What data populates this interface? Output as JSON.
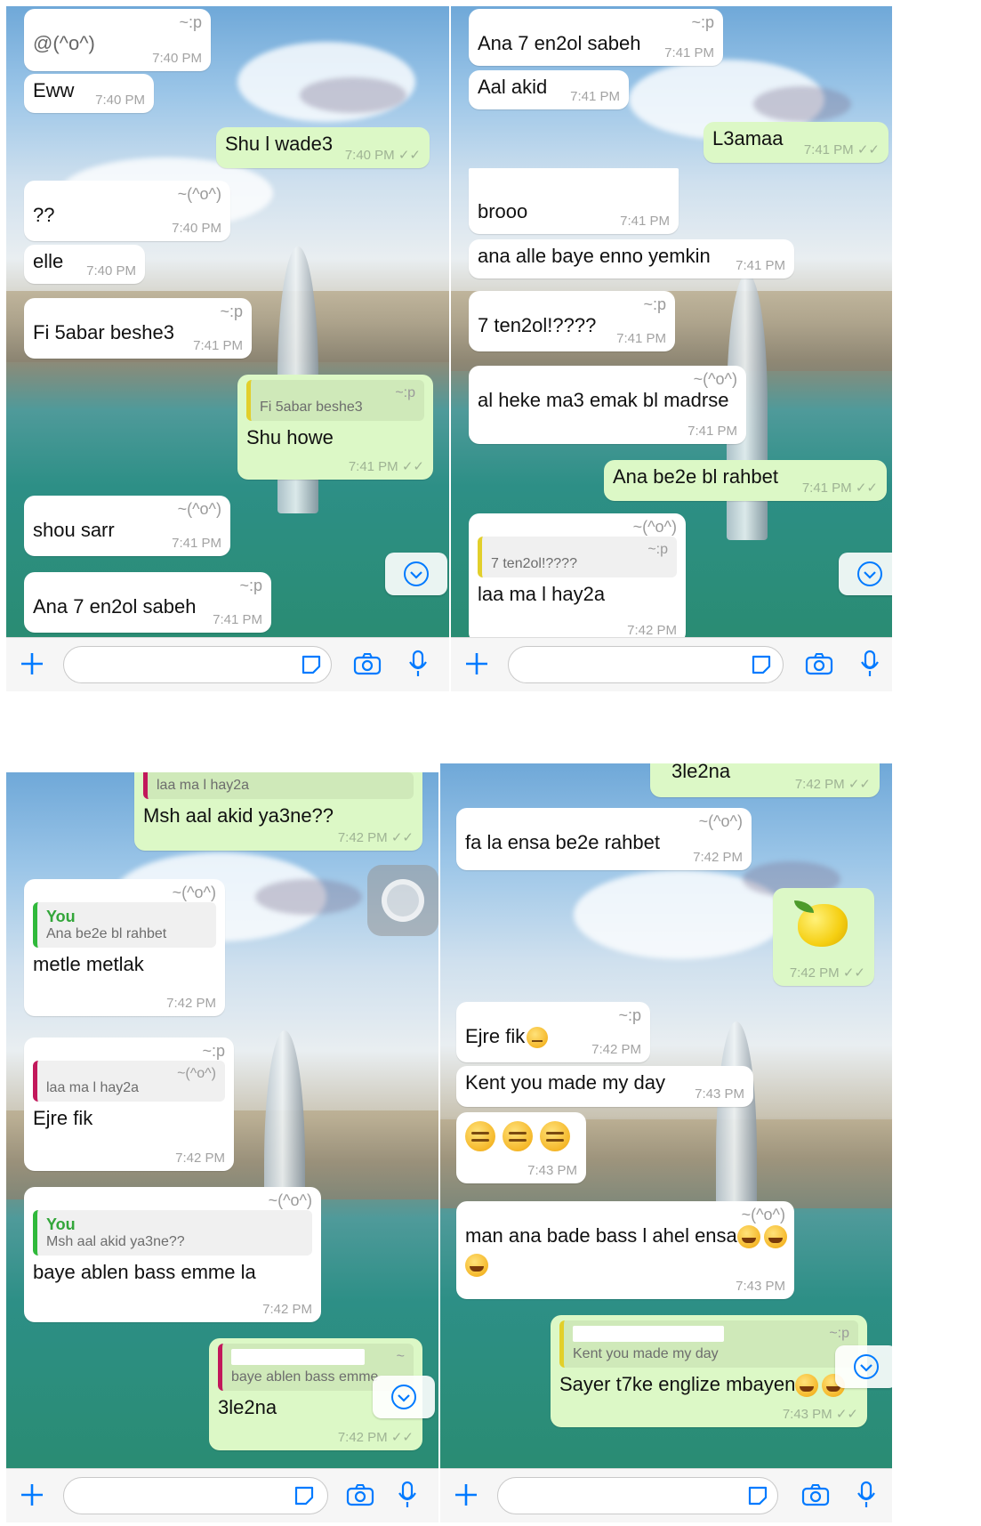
{
  "panels": [
    {
      "messages": [
        {
          "dir": "in",
          "sender": "~:p",
          "text": "@(^o^)",
          "time": "7:40 PM"
        },
        {
          "dir": "in",
          "text": "Eww",
          "time": "7:40 PM"
        },
        {
          "dir": "out",
          "text": "Shu l wade3",
          "time": "7:40 PM"
        },
        {
          "dir": "in",
          "sender": "~(^o^)",
          "text": "??",
          "time": "7:40 PM"
        },
        {
          "dir": "in",
          "text": "elle",
          "time": "7:40 PM"
        },
        {
          "dir": "in",
          "sender": "~:p",
          "text": "Fi 5abar beshe3",
          "time": "7:41 PM"
        },
        {
          "dir": "out",
          "quote_tag": "~:p",
          "quote_text": "Fi 5abar beshe3",
          "text": "Shu howe",
          "time": "7:41 PM"
        },
        {
          "dir": "in",
          "sender": "~(^o^)",
          "text": "shou sarr",
          "time": "7:41 PM"
        },
        {
          "dir": "in",
          "sender": "~:p",
          "text": "Ana 7 en2ol sabeh",
          "time": "7:41 PM"
        }
      ]
    },
    {
      "messages": [
        {
          "dir": "in",
          "sender": "~:p",
          "text": "Ana 7 en2ol sabeh",
          "time": "7:41 PM"
        },
        {
          "dir": "in",
          "text": "Aal akid",
          "time": "7:41 PM"
        },
        {
          "dir": "out",
          "text": "L3amaa",
          "time": "7:41 PM"
        },
        {
          "dir": "in",
          "text": "brooo",
          "time": "7:41 PM"
        },
        {
          "dir": "in",
          "text": "ana alle baye enno yemkin",
          "time": "7:41 PM"
        },
        {
          "dir": "in",
          "sender": "~:p",
          "text": "7 ten2ol!????",
          "time": "7:41 PM"
        },
        {
          "dir": "in",
          "sender": "~(^o^)",
          "text": "al heke ma3 emak bl madrse",
          "time": "7:41 PM"
        },
        {
          "dir": "out",
          "text": "Ana be2e bl rahbet",
          "time": "7:41 PM"
        },
        {
          "dir": "in",
          "sender": "~(^o^)",
          "quote_tag": "~:p",
          "quote_text": "7 ten2ol!????",
          "text": "laa ma l hay2a",
          "time": "7:42 PM"
        }
      ]
    },
    {
      "messages": [
        {
          "dir": "out",
          "quote_text": "laa ma l hay2a",
          "text": "Msh aal akid ya3ne??",
          "time": "7:42 PM"
        },
        {
          "dir": "in",
          "sender": "~(^o^)",
          "quote_author": "You",
          "quote_text": "Ana be2e bl rahbet",
          "text": "metle metlak",
          "time": "7:42 PM"
        },
        {
          "dir": "in",
          "sender": "~:p",
          "quote_tag": "~(^o^)",
          "quote_text": "laa ma l hay2a",
          "text": "Ejre fik",
          "time": "7:42 PM"
        },
        {
          "dir": "in",
          "sender": "~(^o^)",
          "quote_author": "You",
          "quote_text": "Msh aal akid ya3ne??",
          "text": "baye ablen bass emme la",
          "time": "7:42 PM"
        },
        {
          "dir": "out",
          "quote_tag": "~",
          "quote_text": "baye ablen bass emme",
          "text": "3le2na",
          "time": "7:42 PM"
        }
      ]
    },
    {
      "messages": [
        {
          "dir": "out",
          "text": "3le2na",
          "time": "7:42 PM"
        },
        {
          "dir": "in",
          "sender": "~(^o^)",
          "text": "fa la ensa be2e rahbet",
          "time": "7:42 PM"
        },
        {
          "dir": "out",
          "emoji": "lemon",
          "time": "7:42 PM"
        },
        {
          "dir": "in",
          "sender": "~:p",
          "text": "Ejre fik",
          "emoji_inline": "neutral-face",
          "time": "7:42 PM"
        },
        {
          "dir": "in",
          "text": "Kent you made my day",
          "time": "7:43 PM"
        },
        {
          "dir": "in",
          "emoji": "three-expressionless-faces",
          "time": "7:43 PM"
        },
        {
          "dir": "in",
          "sender": "~(^o^)",
          "text": "man ana bade bass l ahel ensa",
          "emoji_inline": "laughing-faces",
          "time": "7:43 PM"
        },
        {
          "dir": "out",
          "quote_tag": "~:p",
          "quote_text": "Kent you made my day",
          "text": "Sayer t7ke englize mbayen",
          "emoji_inline": "laughing-faces",
          "time": "7:43 PM"
        }
      ]
    }
  ],
  "colors": {
    "outgoing": "#dcf8c6",
    "incoming": "#ffffff",
    "accent": "#007aff",
    "quote_you": "#30b93b"
  },
  "icons": [
    "plus-icon",
    "sticker-icon",
    "camera-icon",
    "microphone-icon",
    "chevron-down-icon"
  ]
}
